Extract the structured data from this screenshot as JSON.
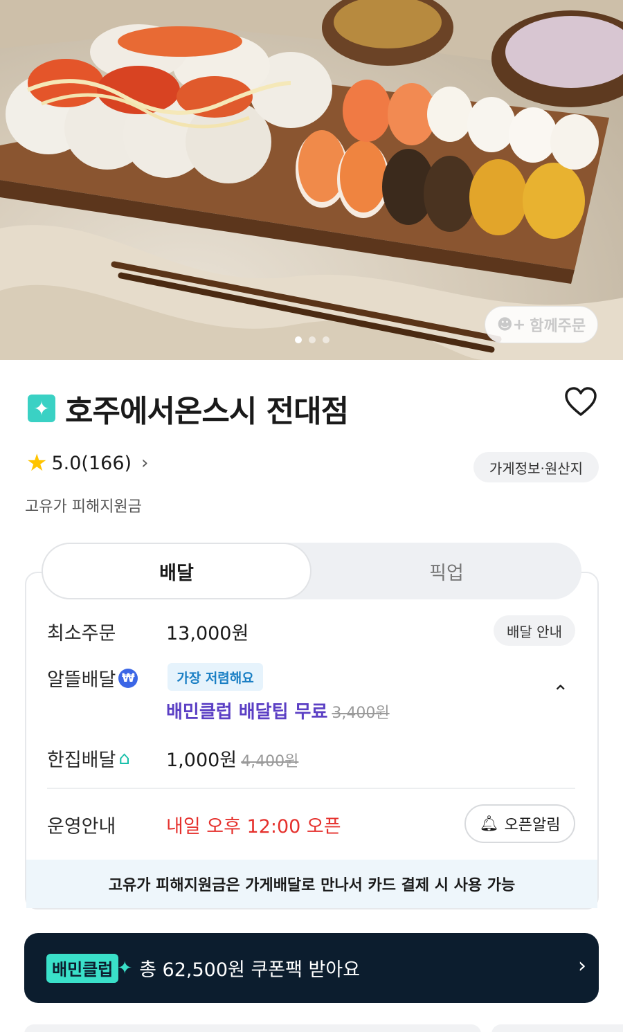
{
  "hero": {
    "together_order_label": "함께주문",
    "page_dots": 3,
    "active_dot": 0
  },
  "store": {
    "name": "호주에서온스시 전대점",
    "rating": "5.0(166)",
    "info_button": "가게정보·원산지",
    "subsidy_label": "고유가 피해지원금"
  },
  "tabs": {
    "delivery": "배달",
    "pickup": "픽업"
  },
  "delivery": {
    "min_order_label": "최소주문",
    "min_order_value": "13,000원",
    "guide_button": "배달 안내",
    "saver_label": "알뜰배달",
    "cheapest_tag": "가장 저렴해요",
    "club_free_text": "배민클럽 배달팁 무료",
    "saver_original_price": "3,400원",
    "single_label": "한집배달",
    "single_price": "1,000원",
    "single_original_price": "4,400원",
    "hours_label": "운영안내",
    "open_time": "내일 오후 12:00 오픈",
    "alarm_button": "오픈알림",
    "notice": "고유가 피해지원금은 가게배달로 만나서 카드 결제 시 사용 가능"
  },
  "club_banner": {
    "logo": "배민클럽",
    "text": "총 62,500원 쿠폰팩 받아요"
  },
  "colors": {
    "accent_teal": "#3ad1c4",
    "open_red": "#e5302c",
    "club_purple": "#5b3fc4",
    "club_dark": "#0c1d2e"
  }
}
